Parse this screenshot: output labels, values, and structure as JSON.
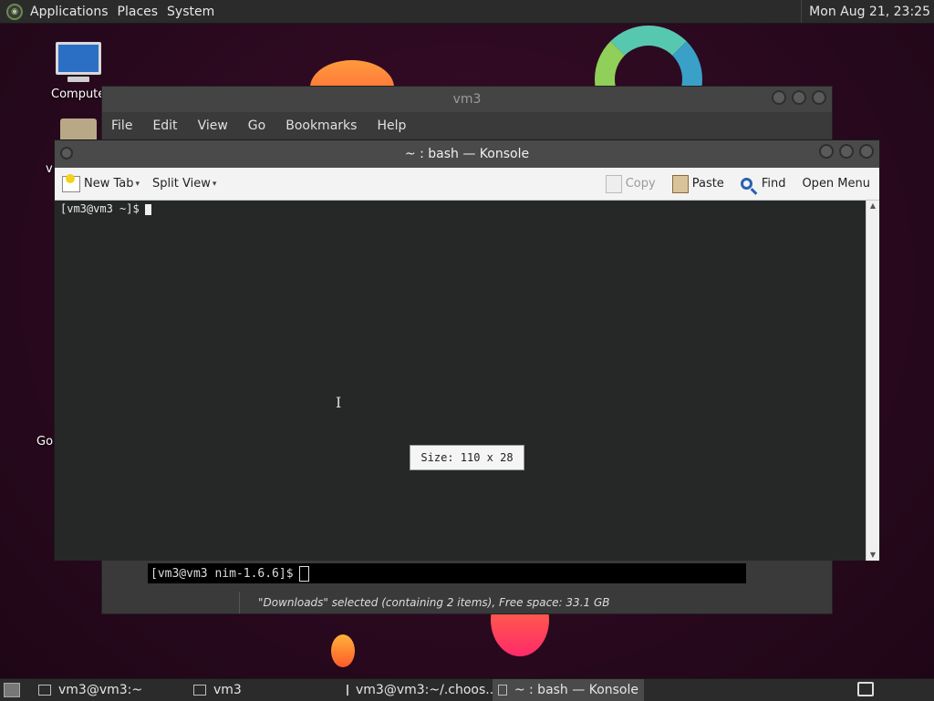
{
  "top_panel": {
    "menus": [
      "Applications",
      "Places",
      "System"
    ],
    "clock": "Mon Aug 21, 23:25"
  },
  "desktop": {
    "icons": [
      {
        "label": "Compute"
      },
      {
        "label": "v"
      },
      {
        "label": "Go"
      }
    ]
  },
  "file_manager": {
    "title": "vm3",
    "menus": [
      "File",
      "Edit",
      "View",
      "Go",
      "Bookmarks",
      "Help"
    ],
    "terminal_prompt": "[vm3@vm3 nim-1.6.6]$",
    "status": "\"Downloads\" selected (containing 2 items), Free space: 33.1 GB"
  },
  "konsole": {
    "title": "~ : bash — Konsole",
    "toolbar": {
      "new_tab": "New Tab",
      "split_view": "Split View",
      "copy": "Copy",
      "paste": "Paste",
      "find": "Find",
      "open_menu": "Open Menu"
    },
    "prompt": "[vm3@vm3 ~]$",
    "size_tooltip": "Size: 110 x 28"
  },
  "taskbar": {
    "tasks": [
      {
        "label": "vm3@vm3:~",
        "active": false
      },
      {
        "label": "vm3",
        "active": false
      },
      {
        "label": "vm3@vm3:~/.choos...",
        "active": false
      },
      {
        "label": "~ : bash — Konsole",
        "active": true
      }
    ]
  }
}
